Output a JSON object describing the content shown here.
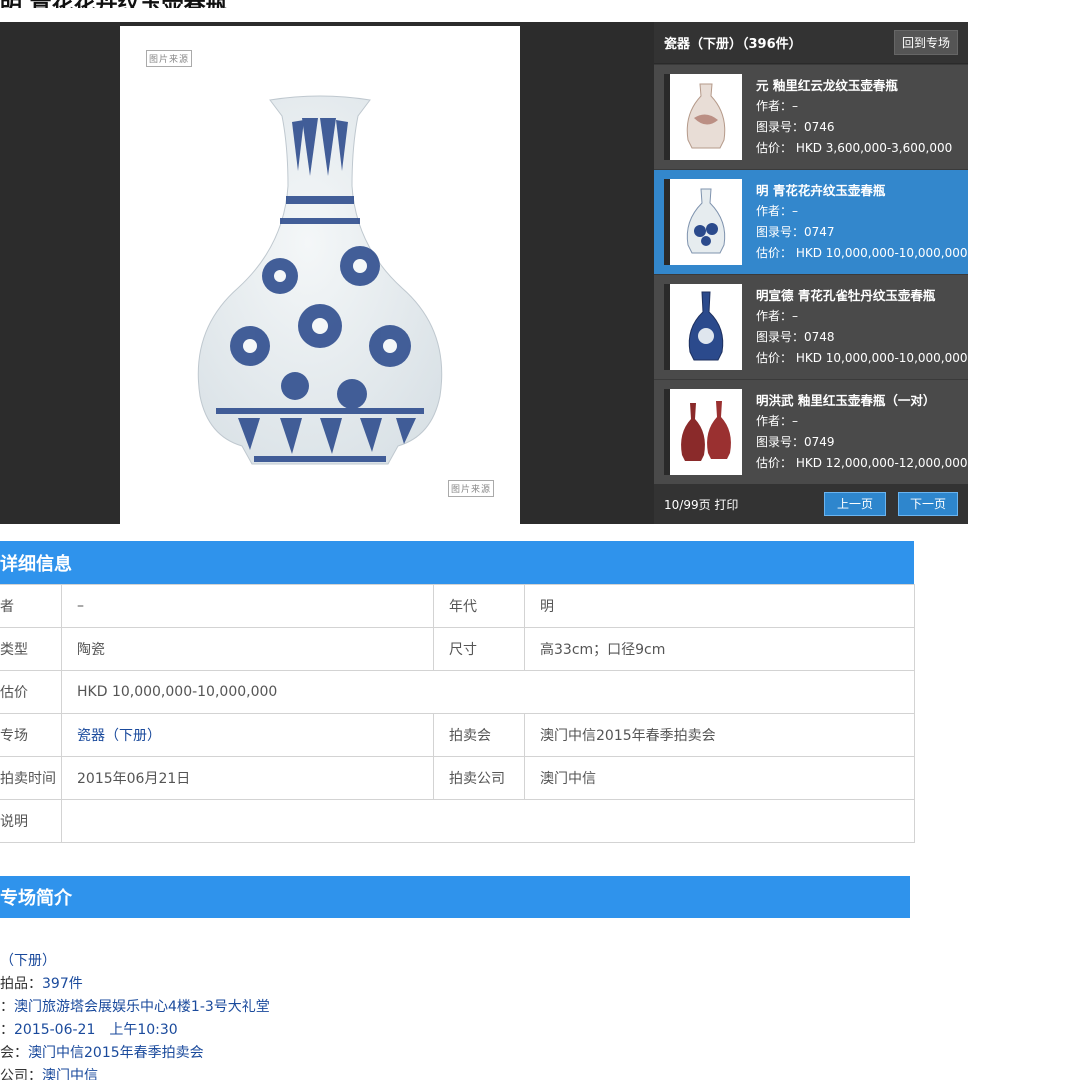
{
  "page": {
    "title": "明 青花花卉纹玉壶春瓶"
  },
  "viewer": {
    "stamp": "图片来源",
    "section_title": "瓷器（下册）（396件）",
    "back_label": "回到专场",
    "pager_text": "10/99页 打印",
    "prev_label": "上一页",
    "next_label": "下一页",
    "lots": [
      {
        "title": "元 釉里红云龙纹玉壶春瓶",
        "author": "作者：–",
        "catalog": "图录号：0746",
        "estimate": "估价： HKD 3,600,000-3,600,000",
        "active": false
      },
      {
        "title": "明 青花花卉纹玉壶春瓶",
        "author": "作者：–",
        "catalog": "图录号：0747",
        "estimate": "估价： HKD 10,000,000-10,000,000",
        "active": true
      },
      {
        "title": "明宣德 青花孔雀牡丹纹玉壶春瓶",
        "author": "作者：–",
        "catalog": "图录号：0748",
        "estimate": "估价： HKD 10,000,000-10,000,000",
        "active": false
      },
      {
        "title": "明洪武 釉里红玉壶春瓶（一对）",
        "author": "作者：–",
        "catalog": "图录号：0749",
        "estimate": "估价： HKD 12,000,000-12,000,000",
        "active": false
      }
    ]
  },
  "detail": {
    "header": "详细信息",
    "rows": [
      {
        "k1": "者",
        "v1": "–",
        "k2": "年代",
        "v2": "明"
      },
      {
        "k1": "类型",
        "v1": "陶瓷",
        "k2": "尺寸",
        "v2": "高33cm；口径9cm"
      },
      {
        "k1": "估价",
        "v1": "HKD 10,000,000-10,000,000"
      },
      {
        "k1": "专场",
        "v1": "瓷器（下册）",
        "k2": "拍卖会",
        "v2": "澳门中信2015年春季拍卖会"
      },
      {
        "k1": "拍卖时间",
        "v1": "2015年06月21日",
        "k2": "拍卖公司",
        "v2": "澳门中信"
      },
      {
        "k1": "说明",
        "v1": ""
      }
    ]
  },
  "intro": {
    "header": "专场简介",
    "lines": [
      {
        "k": "",
        "v": "（下册）"
      },
      {
        "k": "拍品：",
        "v": "397件"
      },
      {
        "k": "：",
        "v": "澳门旅游塔会展娱乐中心4楼1-3号大礼堂"
      },
      {
        "k": "：",
        "v": "2015-06-21　上午10:30"
      },
      {
        "k": "会：",
        "v": "澳门中信2015年春季拍卖会"
      },
      {
        "k": "公司：",
        "v": "澳门中信"
      }
    ]
  },
  "colors": {
    "accent": "#2f93ec",
    "active_row": "#3387cc",
    "dark_bg": "#2c2c2c",
    "link": "#1a4a9c"
  }
}
